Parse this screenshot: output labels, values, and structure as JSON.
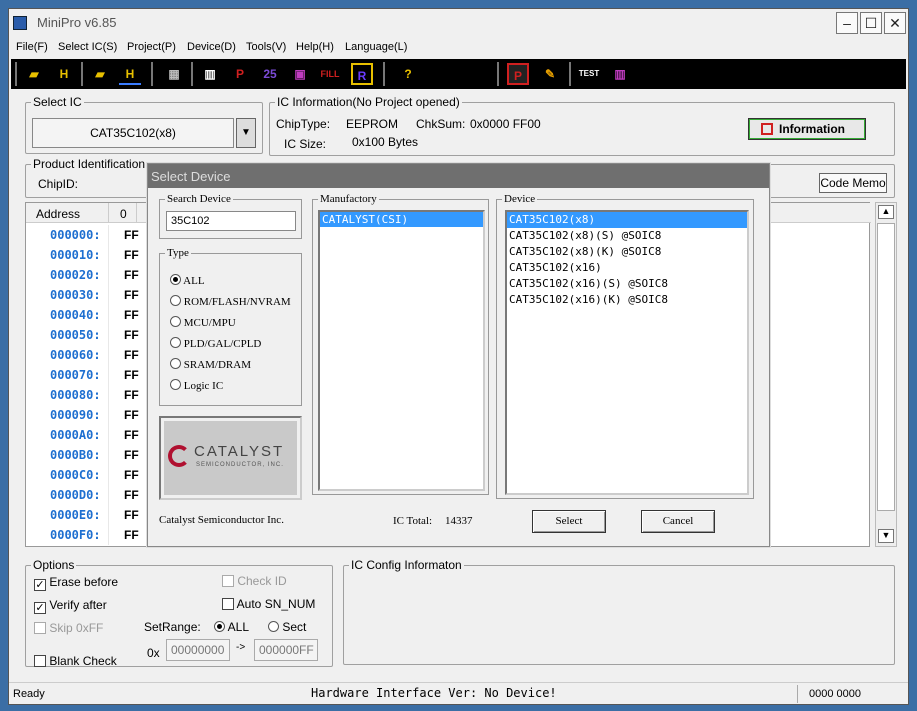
{
  "window": {
    "title": "MiniPro v6.85",
    "min": "–",
    "max": "☐",
    "close": "✕"
  },
  "menu": [
    "File(F)",
    "Select IC(S)",
    "Project(P)",
    "Device(D)",
    "Tools(V)",
    "Help(H)",
    "Language(L)"
  ],
  "toolbar": {
    "help_label": "?",
    "test_label": "TEST",
    "r_label": "R",
    "p_label": "P"
  },
  "select_ic": {
    "label": "Select IC",
    "value": "CAT35C102(x8)"
  },
  "ic_info": {
    "label": "IC Information(No Project opened)",
    "chiptype_label": "ChipType:",
    "chiptype": "EEPROM",
    "chksum_label": "ChkSum:",
    "chksum": "0x0000 FF00",
    "size_label": "IC Size:",
    "size": "0x100 Bytes",
    "info_button": "Information"
  },
  "product": {
    "label": "Product Identification",
    "chipid_label": "ChipID:",
    "code_memo": "Code Memo"
  },
  "hex": {
    "address_header": "Address",
    "col0_header": "0",
    "rows": [
      {
        "addr": "000000:",
        "v": "FF"
      },
      {
        "addr": "000010:",
        "v": "FF"
      },
      {
        "addr": "000020:",
        "v": "FF"
      },
      {
        "addr": "000030:",
        "v": "FF"
      },
      {
        "addr": "000040:",
        "v": "FF"
      },
      {
        "addr": "000050:",
        "v": "FF"
      },
      {
        "addr": "000060:",
        "v": "FF"
      },
      {
        "addr": "000070:",
        "v": "FF"
      },
      {
        "addr": "000080:",
        "v": "FF"
      },
      {
        "addr": "000090:",
        "v": "FF"
      },
      {
        "addr": "0000A0:",
        "v": "FF"
      },
      {
        "addr": "0000B0:",
        "v": "FF"
      },
      {
        "addr": "0000C0:",
        "v": "FF"
      },
      {
        "addr": "0000D0:",
        "v": "FF"
      },
      {
        "addr": "0000E0:",
        "v": "FF"
      },
      {
        "addr": "0000F0:",
        "v": "FF"
      }
    ]
  },
  "options": {
    "label": "Options",
    "erase_before": "Erase before",
    "verify_after": "Verify after",
    "skip_0xff": "Skip 0xFF",
    "blank_check": "Blank Check",
    "check_id": "Check ID",
    "auto_sn": "Auto SN_NUM",
    "setrange_label": "SetRange:",
    "all": "ALL",
    "sect": "Sect",
    "prefix": "0x",
    "range_from": "00000000",
    "arrow": "->",
    "range_to": "000000FF"
  },
  "ic_config": {
    "label": "IC Config Informaton"
  },
  "status": {
    "left": "Ready",
    "center": "Hardware Interface Ver: No Device!",
    "right": "0000 0000"
  },
  "dialog": {
    "title": "Select Device",
    "search_label": "Search Device",
    "search_value": "35C102",
    "type_label": "Type",
    "types": [
      "ALL",
      "ROM/FLASH/NVRAM",
      "MCU/MPU",
      "PLD/GAL/CPLD",
      "SRAM/DRAM",
      "Logic IC"
    ],
    "manufactory_label": "Manufactory",
    "manufacturers": [
      "CATALYST(CSI)"
    ],
    "device_label": "Device",
    "devices": [
      "CAT35C102(x8)",
      "CAT35C102(x8)(S) @SOIC8",
      "CAT35C102(x8)(K) @SOIC8",
      "CAT35C102(x16)",
      "CAT35C102(x16)(S) @SOIC8",
      "CAT35C102(x16)(K) @SOIC8"
    ],
    "logo_word": "CATALYST",
    "logo_sub": "SEMICONDUCTOR, INC.",
    "company": "Catalyst Semiconductor Inc.",
    "ic_total_label": "IC Total:",
    "ic_total": "14337",
    "select_button": "Select",
    "cancel_button": "Cancel"
  }
}
